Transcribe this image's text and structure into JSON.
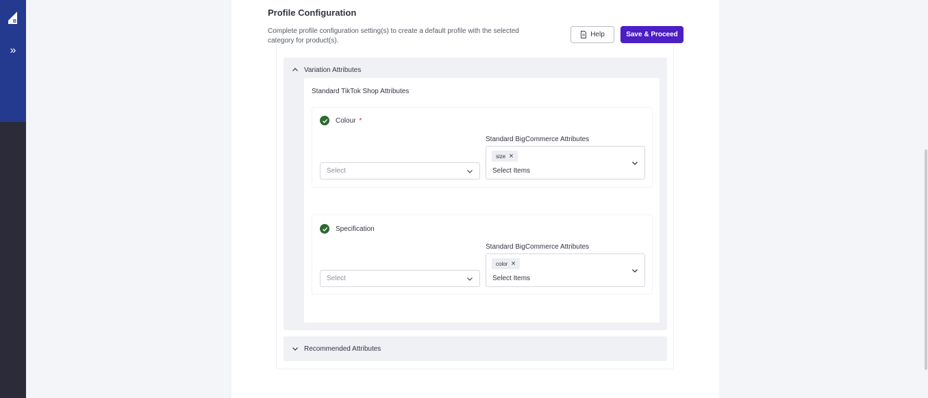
{
  "sidebar": {
    "logo_icon": "bigcommerce-logo",
    "expand_icon": "double-chevron-right-icon",
    "expand_label": "»"
  },
  "header": {
    "title": "Profile Configuration",
    "description": "Complete profile configuration setting(s) to create a default profile with the selected category for product(s).",
    "help_label": "Help",
    "help_icon": "document-icon",
    "save_label": "Save & Proceed",
    "save_color": "#4b1fc4"
  },
  "variation": {
    "title": "Variation Attributes",
    "expanded": true,
    "section_title": "Standard TikTok Shop Attributes",
    "attributes": [
      {
        "name": "Colour",
        "required": "*",
        "status_icon": "check-circle-icon",
        "select_placeholder": "Select",
        "bc_label": "Standard BigCommerce Attributes",
        "chip": "size",
        "multi_placeholder": "Select Items"
      },
      {
        "name": "Specification",
        "required": "",
        "status_icon": "check-circle-icon",
        "select_placeholder": "Select",
        "bc_label": "Standard BigCommerce Attributes",
        "chip": "color",
        "multi_placeholder": "Select Items"
      }
    ]
  },
  "recommended": {
    "title": "Recommended Attributes",
    "expanded": false
  },
  "colors": {
    "sidebar_top": "#233a8e",
    "sidebar": "#2b2b3a",
    "check": "#2e6a30",
    "required": "#d9262e"
  }
}
